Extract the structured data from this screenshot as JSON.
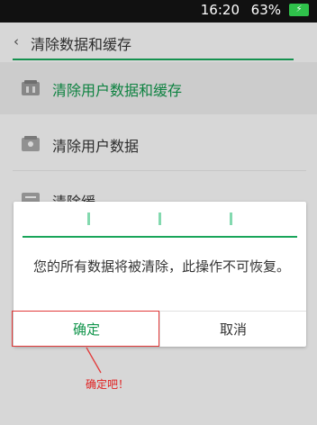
{
  "statusbar": {
    "time": "16:20",
    "battery_percent": "63%",
    "battery_icon": "charging-battery-icon",
    "bolt_glyph": "⚡"
  },
  "header": {
    "back_glyph": "‹",
    "title": "清除数据和缓存"
  },
  "list": {
    "items": [
      {
        "label": "清除用户数据和缓存",
        "icon": "clear-data-cache-icon"
      },
      {
        "label": "清除用户数据",
        "icon": "clear-user-data-icon"
      },
      {
        "label": "清除缓",
        "icon": "clear-cache-icon"
      }
    ]
  },
  "dialog": {
    "message": "您的所有数据将被清除，此操作不可恢复。",
    "ok_label": "确定",
    "cancel_label": "取消"
  },
  "annotation": {
    "text": "确定吧！",
    "color": "#e02020"
  },
  "colors": {
    "accent_green": "#19a55a",
    "status_bar": "#111111"
  }
}
